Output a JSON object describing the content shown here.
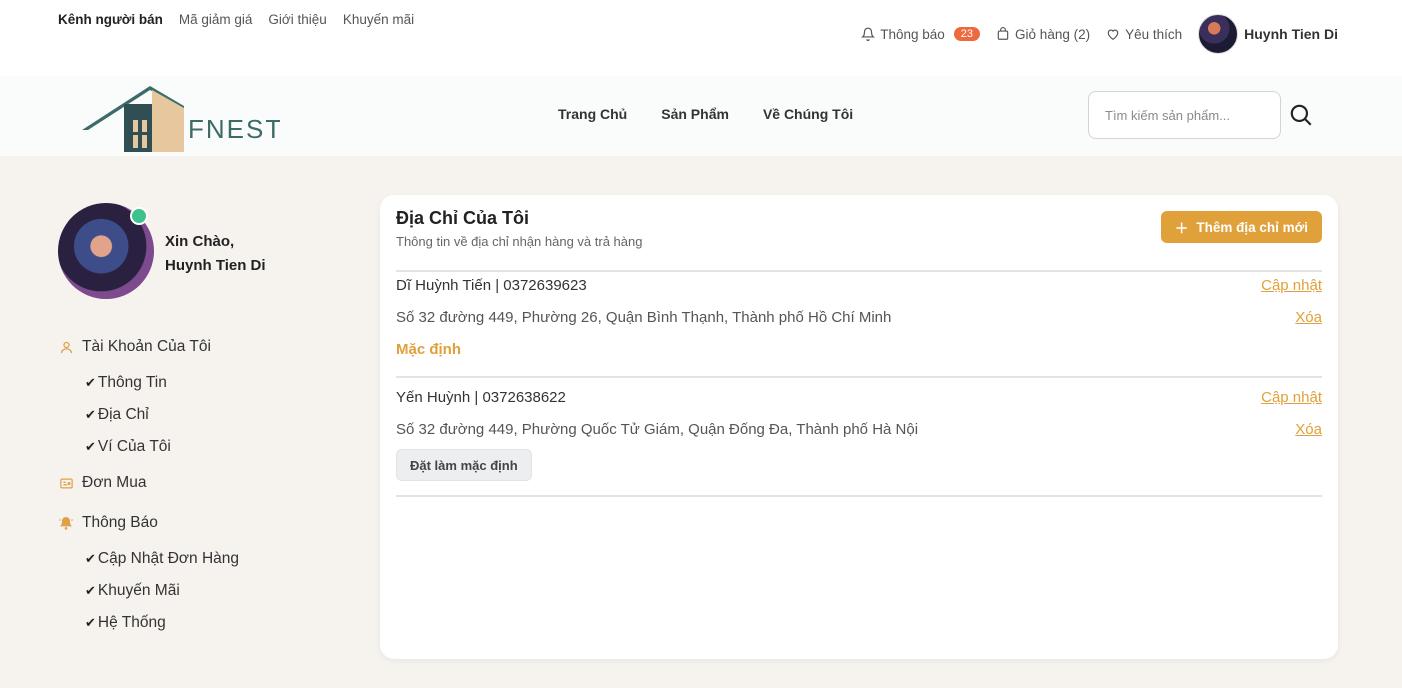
{
  "topbar": {
    "left_links": [
      "Kênh người bán",
      "Mã giảm giá",
      "Giới thiệu",
      "Khuyến mãi"
    ],
    "notifications_label": "Thông báo",
    "notifications_count": "23",
    "cart_label": "Giỏ hàng (2)",
    "favorites_label": "Yêu thích",
    "user_name": "Huynh Tien Di"
  },
  "header": {
    "logo_text": "FNEST",
    "nav": [
      "Trang Chủ",
      "Sản Phẩm",
      "Về Chúng Tôi"
    ],
    "search_placeholder": "Tìm kiếm sản phẩm..."
  },
  "sidebar": {
    "greeting_line1": "Xin Chào,",
    "greeting_line2": "Huynh Tien Di",
    "account_label": "Tài Khoản Của Tôi",
    "account_items": [
      "Thông Tin",
      "Địa Chỉ",
      "Ví Của Tôi"
    ],
    "orders_label": "Đơn Mua",
    "notify_label": "Thông Báo",
    "notify_items": [
      "Cập Nhật Đơn Hàng",
      "Khuyến Mãi",
      "Hệ Thống"
    ]
  },
  "main": {
    "title": "Địa Chỉ Của Tôi",
    "subtitle": "Thông tin về địa chỉ nhận hàng và trả hàng",
    "add_button": "Thêm địa chỉ mới",
    "addresses": [
      {
        "name_phone": "Dĩ Huỳnh Tiến | 0372639623",
        "address": "Số 32 đường 449, Phường 26, Quận Bình Thạnh, Thành phố Hồ Chí Minh",
        "update": "Cập nhật",
        "delete": "Xóa",
        "default_label": "Mặc định"
      },
      {
        "name_phone": "Yến Huỳnh | 0372638622",
        "address": "Số 32 đường 449, Phường Quốc Tử Giám, Quận Đống Đa, Thành phố Hà Nội",
        "update": "Cập nhật",
        "delete": "Xóa",
        "set_default": "Đặt làm mặc định"
      }
    ]
  },
  "colors": {
    "accent": "#e0a03a",
    "badge": "#ec6a3e",
    "online": "#3cc28a",
    "logo_teal": "#3d6b68",
    "logo_beige": "#e6c79e"
  }
}
